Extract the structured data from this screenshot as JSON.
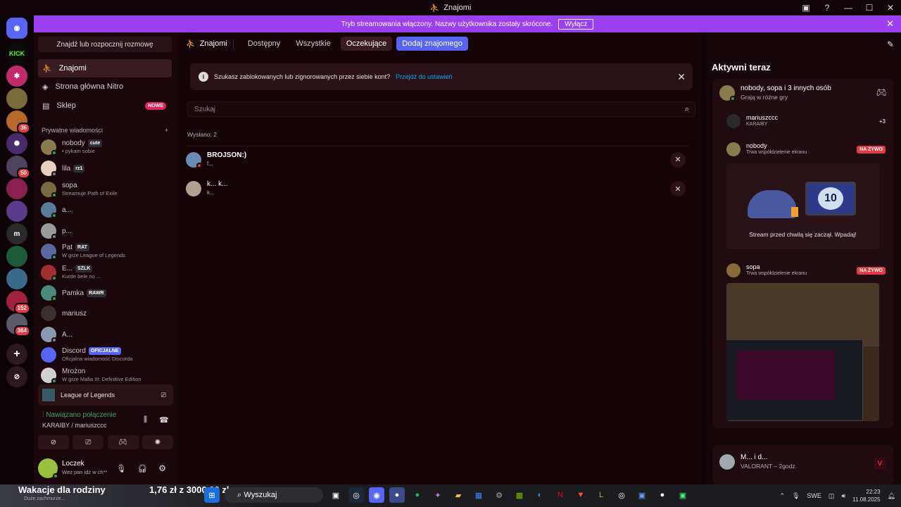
{
  "window": {
    "title": "Znajomi"
  },
  "banner": {
    "text": "Tryb streamowania włączony. Nazwy użytkownika zostały skrócone.",
    "button": "Wyłącz"
  },
  "rail": {
    "items": [
      {
        "label": "KICK"
      },
      {
        "badge": "36"
      },
      {
        "badge": "50"
      },
      {
        "label": "m"
      },
      {
        "badge": "152"
      },
      {
        "badge": "364"
      }
    ]
  },
  "sidebar": {
    "search": "Znajdź lub rozpocznij rozmowę",
    "nav": [
      {
        "label": "Znajomi"
      },
      {
        "label": "Strona główna Nitro"
      },
      {
        "label": "Sklep",
        "badge": "NOWE"
      }
    ],
    "pm_header": "Prywatne wiadomości",
    "pm_add": "+",
    "dms": [
      {
        "name": "nobody",
        "tag": "cute",
        "sub": "• pykam sobie"
      },
      {
        "name": "lila",
        "tag": "rz1",
        "sub": ""
      },
      {
        "name": "sopa",
        "tag": "",
        "sub": "Streamuje Path of Exile"
      },
      {
        "name": "a...",
        "tag": "",
        "sub": ""
      },
      {
        "name": "p...",
        "tag": "",
        "sub": ""
      },
      {
        "name": "Pat",
        "tag": "RAT",
        "sub": "W grze League of Legends"
      },
      {
        "name": "E...",
        "tag": "SZLK",
        "sub": "Kurde bele no ..."
      },
      {
        "name": "Pamka",
        "tag": "RAWR",
        "sub": ""
      },
      {
        "name": "mariusz",
        "tag": "",
        "sub": ""
      },
      {
        "name": "A...",
        "tag": "",
        "sub": ""
      },
      {
        "name": "Discord",
        "tag": "OFICJALNE",
        "sub": "Oficjalna wiadomość Discorda"
      },
      {
        "name": "Mrożon",
        "tag": "",
        "sub": "W grze Mafia III: Definitive Edition"
      }
    ]
  },
  "voice": {
    "game": "League of Legends",
    "status": "Nawiązano połączenie",
    "channel": "KARAIBY / mariuszccc",
    "user": {
      "name": "Loczek",
      "status": "Wez pan idz w ch**"
    }
  },
  "main": {
    "tabs": {
      "friends": "Znajomi",
      "online": "Dostępny",
      "all": "Wszystkie",
      "pending": "Oczekujące",
      "add": "Dodaj znajomego"
    },
    "notice": {
      "text": "Szukasz zablokowanych lub zignorowanych przez siebie kont?",
      "link": "Przejdź do ustawień"
    },
    "search_placeholder": "Szukaj",
    "sent_label": "Wysłano: 2",
    "requests": [
      {
        "name": "BROJSON:)",
        "tag": "f..."
      },
      {
        "name": "k... k...",
        "tag": "k..."
      }
    ]
  },
  "activity": {
    "title": "Aktywni teraz",
    "group": {
      "name": "nobody, sopa i 3 innych osób",
      "sub": "Grają w różne gry"
    },
    "voice": {
      "name": "mariuszccc",
      "channel": "KARAIBY",
      "extra": "+3"
    },
    "streams": [
      {
        "name": "nobody",
        "sub": "Trwa współdzielenie ekranu",
        "badge": "NA ŻYWO",
        "caption": "Stream przed chwilą się zaczął. Wpadaj!"
      },
      {
        "name": "sopa",
        "sub": "Trwa współdzielenie ekranu",
        "badge": "NA ŻYWO"
      }
    ],
    "second": {
      "name": "M... i d...",
      "sub": "VALORANT – 2godz."
    }
  },
  "taskbar": {
    "news_title": "Wakacje dla rodziny",
    "news_sub": "Duże zachmurze...",
    "price": "1,76 zł  z 3000,00 zł",
    "search": "Wyszukaj",
    "lang": "SWE",
    "time": "22:23",
    "date": "11.08.2025"
  },
  "colors": {
    "accent": "#5865f2",
    "banner": "#9b3ff0",
    "live": "#e23b45",
    "online": "#23a55a"
  }
}
